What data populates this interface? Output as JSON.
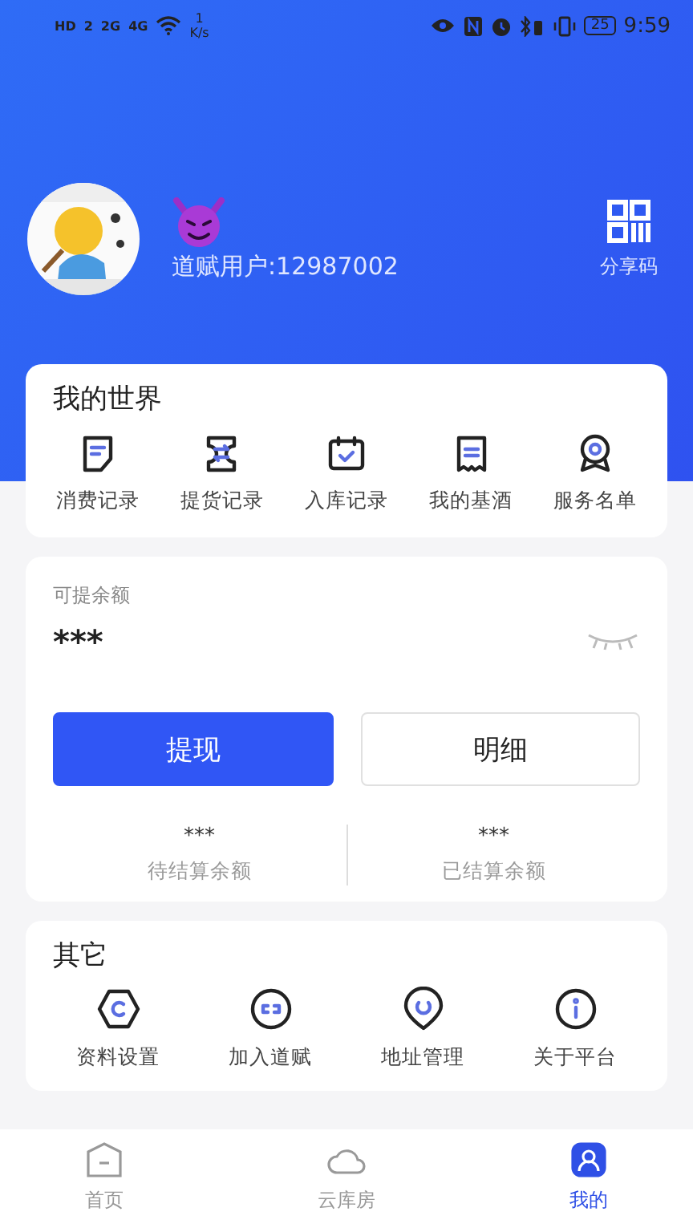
{
  "status_bar": {
    "indicators": [
      "HD",
      "2",
      "2G",
      "4G"
    ],
    "speed_value": "1",
    "speed_unit": "K/s",
    "battery": "25",
    "time": "9:59"
  },
  "profile": {
    "username": "道赋用户:12987002",
    "share": {
      "label": "分享码"
    }
  },
  "world": {
    "title": "我的世界",
    "items": [
      {
        "label": "消费记录",
        "kind": "note"
      },
      {
        "label": "提货记录",
        "kind": "exchange"
      },
      {
        "label": "入库记录",
        "kind": "calendar"
      },
      {
        "label": "我的基酒",
        "kind": "receipt"
      },
      {
        "label": "服务名单",
        "kind": "badge"
      }
    ]
  },
  "balance": {
    "label": "可提余额",
    "amount": "***",
    "hidden": true,
    "buttons": [
      {
        "label": "提现",
        "primary": true
      },
      {
        "label": "明细",
        "primary": false
      }
    ],
    "stats": [
      {
        "value": "***",
        "label": "待结算余额"
      },
      {
        "value": "***",
        "label": "已结算余额"
      }
    ]
  },
  "other": {
    "title": "其它",
    "items": [
      {
        "label": "资料设置",
        "kind": "hexagon"
      },
      {
        "label": "加入道赋",
        "kind": "link"
      },
      {
        "label": "地址管理",
        "kind": "pin"
      },
      {
        "label": "关于平台",
        "kind": "info"
      }
    ]
  },
  "tabs": [
    {
      "label": "首页",
      "kind": "home",
      "selected": false
    },
    {
      "label": "云库房",
      "kind": "cloud",
      "selected": false
    },
    {
      "label": "我的",
      "kind": "user",
      "selected": true
    }
  ]
}
